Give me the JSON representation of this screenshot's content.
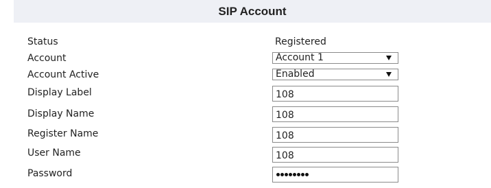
{
  "header": {
    "title": "SIP Account"
  },
  "fields": {
    "status": {
      "label": "Status",
      "value": "Registered"
    },
    "account": {
      "label": "Account",
      "selected": "Account 1",
      "icon": "chevron-down-icon"
    },
    "account_active": {
      "label": "Account Active",
      "selected": "Enabled",
      "icon": "chevron-down-icon"
    },
    "display_label": {
      "label": "Display Label",
      "value": "108"
    },
    "display_name": {
      "label": "Display Name",
      "value": "108"
    },
    "register_name": {
      "label": "Register Name",
      "value": "108"
    },
    "user_name": {
      "label": "User Name",
      "value": "108"
    },
    "password": {
      "label": "Password",
      "masked_value": "••••••••",
      "masked_length": 8
    }
  },
  "colors": {
    "header_background": "#eef0f5",
    "input_border": "#8a8a8a",
    "text": "#222222"
  }
}
